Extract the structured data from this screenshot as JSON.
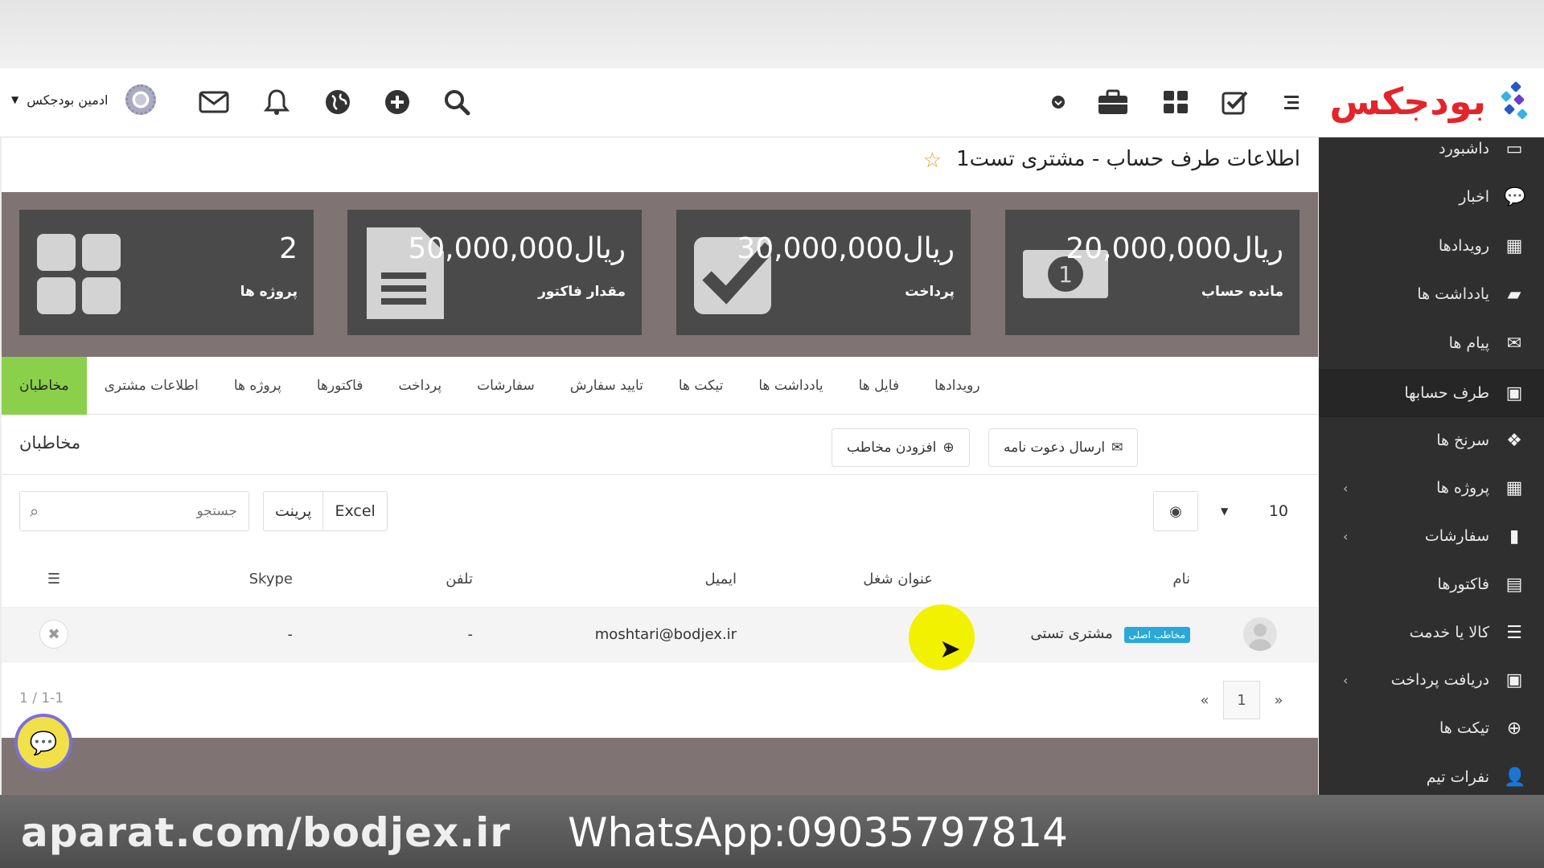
{
  "header": {
    "logo_text": "بودجکس",
    "user_name": "ادمین بودجکس",
    "icons": [
      "search-icon",
      "plus-circle-icon",
      "globe-icon",
      "bell-icon",
      "envelope-icon",
      "fingerprint-icon",
      "heart-icon",
      "briefcase-icon",
      "grid-icon",
      "checkbox-icon",
      "list-icon"
    ]
  },
  "page": {
    "title": "اطلاعات طرف حساب - مشتری تست1"
  },
  "stats": [
    {
      "value": "ریال20,000,000",
      "label": "مانده حساب",
      "icon": "money-icon"
    },
    {
      "value": "ریال30,000,000",
      "label": "پرداخت",
      "icon": "check-icon"
    },
    {
      "value": "ریال50,000,000",
      "label": "مقدار فاکتور",
      "icon": "document-icon"
    },
    {
      "value": "2",
      "label": "پروژه ها",
      "icon": "grid-icon"
    }
  ],
  "tabs": [
    {
      "label": "مخاطبان",
      "active": true
    },
    {
      "label": "اطلاعات مشتری"
    },
    {
      "label": "پروژه ها"
    },
    {
      "label": "فاکتورها"
    },
    {
      "label": "پرداخت"
    },
    {
      "label": "سفارشات"
    },
    {
      "label": "تایید سفارش"
    },
    {
      "label": "تیکت ها"
    },
    {
      "label": "یادداشت ها"
    },
    {
      "label": "فایل ها"
    },
    {
      "label": "رویدادها"
    }
  ],
  "contacts": {
    "title": "مخاطبان",
    "send_invite": "ارسال دعوت نامه",
    "add_contact": "افزودن مخاطب",
    "search_placeholder": "جستجو",
    "print_label": "پرینت",
    "excel_label": "Excel",
    "page_size": "10",
    "columns": [
      "نام",
      "عنوان شغل",
      "ایمیل",
      "تلفن",
      "Skype"
    ],
    "rows": [
      {
        "name": "مشتری تستی",
        "badge": "مخاطب اصلی",
        "job_title": "",
        "email": "moshtari@bodjex.ir",
        "phone": "-",
        "skype": "-"
      }
    ],
    "pager": {
      "prev": "«",
      "current": "1",
      "next": "»"
    },
    "count": "1 / 1-1"
  },
  "sidebar": {
    "items": [
      {
        "label": "داشبورد",
        "icon": "monitor-icon"
      },
      {
        "label": "اخبار",
        "icon": "comments-icon"
      },
      {
        "label": "رویدادها",
        "icon": "calendar-icon"
      },
      {
        "label": "یادداشت ها",
        "icon": "book-icon"
      },
      {
        "label": "پیام ها",
        "icon": "envelope-icon"
      },
      {
        "label": "طرف حسابها",
        "icon": "briefcase-icon",
        "active": true
      },
      {
        "label": "سرنخ ها",
        "icon": "cubes-icon"
      },
      {
        "label": "پروژه ها",
        "icon": "grid-icon",
        "chevron": "‹"
      },
      {
        "label": "سفارشات",
        "icon": "file-icon",
        "chevron": "‹"
      },
      {
        "label": "فاکتورها",
        "icon": "file-text-icon"
      },
      {
        "label": "کالا یا خدمت",
        "icon": "list-icon"
      },
      {
        "label": "دریافت پرداخت",
        "icon": "money-icon",
        "chevron": "‹"
      },
      {
        "label": "تیکت ها",
        "icon": "lifebuoy-icon"
      },
      {
        "label": "نفرات تیم",
        "icon": "user-icon"
      }
    ]
  },
  "watermark": {
    "left": "aparat.com/bodjex.ir",
    "right": "WhatsApp:09035797814"
  },
  "colors": {
    "brand_red": "#e3242b",
    "tab_active": "#8bd04a",
    "sidebar_bg": "#2f2f2f",
    "stat_tile": "#4a4a4a",
    "badge_blue": "#2aa8d8"
  }
}
